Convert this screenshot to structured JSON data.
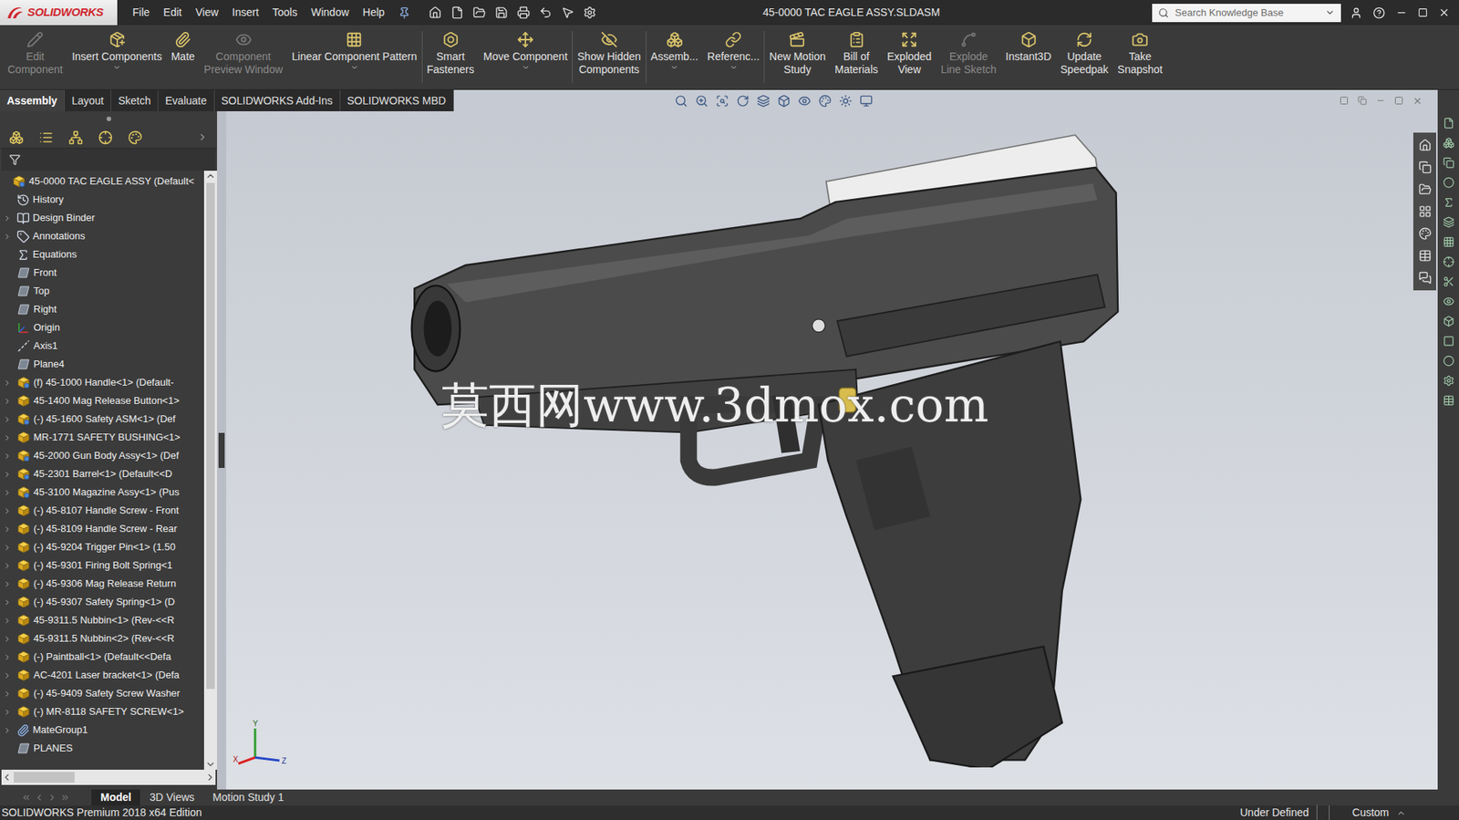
{
  "window": {
    "title": "45-0000 TAC EAGLE ASSY.SLDASM"
  },
  "logo": {
    "brand": "SOLIDWORKS"
  },
  "menu": [
    "File",
    "Edit",
    "View",
    "Insert",
    "Tools",
    "Window",
    "Help"
  ],
  "search": {
    "placeholder": "Search Knowledge Base"
  },
  "ribbon": [
    {
      "label": [
        "Edit",
        "Component"
      ],
      "disabled": true,
      "dropdown": false,
      "group_start": false
    },
    {
      "label": [
        "Insert Components"
      ],
      "disabled": false,
      "dropdown": true,
      "group_start": false
    },
    {
      "label": [
        "Mate"
      ],
      "disabled": false,
      "dropdown": false,
      "group_start": false
    },
    {
      "label": [
        "Component",
        "Preview Window"
      ],
      "disabled": true,
      "dropdown": false,
      "group_start": false
    },
    {
      "label": [
        "Linear Component Pattern"
      ],
      "disabled": false,
      "dropdown": true,
      "group_start": false
    },
    {
      "label": [
        "Smart",
        "Fasteners"
      ],
      "disabled": false,
      "dropdown": false,
      "group_start": true
    },
    {
      "label": [
        "Move Component"
      ],
      "disabled": false,
      "dropdown": true,
      "group_start": false
    },
    {
      "label": [
        "Show Hidden",
        "Components"
      ],
      "disabled": false,
      "dropdown": false,
      "group_start": true
    },
    {
      "label": [
        "Assemb..."
      ],
      "disabled": false,
      "dropdown": true,
      "group_start": true
    },
    {
      "label": [
        "Referenc..."
      ],
      "disabled": false,
      "dropdown": true,
      "group_start": false
    },
    {
      "label": [
        "New Motion",
        "Study"
      ],
      "disabled": false,
      "dropdown": false,
      "group_start": true
    },
    {
      "label": [
        "Bill of",
        "Materials"
      ],
      "disabled": false,
      "dropdown": false,
      "group_start": false
    },
    {
      "label": [
        "Exploded",
        "View"
      ],
      "disabled": false,
      "dropdown": false,
      "group_start": false
    },
    {
      "label": [
        "Explode",
        "Line Sketch"
      ],
      "disabled": true,
      "dropdown": false,
      "group_start": false
    },
    {
      "label": [
        "Instant3D"
      ],
      "disabled": false,
      "dropdown": false,
      "group_start": false
    },
    {
      "label": [
        "Update",
        "Speedpak"
      ],
      "disabled": false,
      "dropdown": false,
      "group_start": false
    },
    {
      "label": [
        "Take",
        "Snapshot"
      ],
      "disabled": false,
      "dropdown": false,
      "group_start": false
    }
  ],
  "command_tabs": [
    {
      "label": "Assembly",
      "selected": true
    },
    {
      "label": "Layout",
      "selected": false
    },
    {
      "label": "Sketch",
      "selected": false
    },
    {
      "label": "Evaluate",
      "selected": false
    },
    {
      "label": "SOLIDWORKS Add-Ins",
      "selected": false
    },
    {
      "label": "SOLIDWORKS MBD",
      "selected": false
    }
  ],
  "feature_tree": [
    {
      "label": "45-0000 TAC EAGLE ASSY  (Default<",
      "expandable": false,
      "icon": "root"
    },
    {
      "label": "History",
      "expandable": false,
      "icon": "history"
    },
    {
      "label": "Design Binder",
      "expandable": true,
      "icon": "binder"
    },
    {
      "label": "Annotations",
      "expandable": true,
      "icon": "annotations"
    },
    {
      "label": "Equations",
      "expandable": false,
      "icon": "equations"
    },
    {
      "label": "Front",
      "expandable": false,
      "icon": "plane"
    },
    {
      "label": "Top",
      "expandable": false,
      "icon": "plane"
    },
    {
      "label": "Right",
      "expandable": false,
      "icon": "plane"
    },
    {
      "label": "Origin",
      "expandable": false,
      "icon": "origin"
    },
    {
      "label": "Axis1",
      "expandable": false,
      "icon": "axis"
    },
    {
      "label": "Plane4",
      "expandable": false,
      "icon": "plane"
    },
    {
      "label": "(f) 45-1000 Handle<1> (Default-",
      "expandable": true,
      "icon": "assembly"
    },
    {
      "label": "45-1400 Mag Release Button<1>",
      "expandable": true,
      "icon": "part"
    },
    {
      "label": "(-) 45-1600 Safety ASM<1> (Def",
      "expandable": true,
      "icon": "assembly"
    },
    {
      "label": "MR-1771 SAFETY BUSHING<1>",
      "expandable": true,
      "icon": "part"
    },
    {
      "label": "45-2000 Gun Body Assy<1> (Def",
      "expandable": true,
      "icon": "assembly"
    },
    {
      "label": "45-2301 Barrel<1> (Default<<D",
      "expandable": true,
      "icon": "assembly"
    },
    {
      "label": "45-3100 Magazine Assy<1> (Pus",
      "expandable": true,
      "icon": "assembly"
    },
    {
      "label": "(-) 45-8107 Handle Screw - Front",
      "expandable": true,
      "icon": "part"
    },
    {
      "label": "(-) 45-8109 Handle Screw - Rear",
      "expandable": true,
      "icon": "part"
    },
    {
      "label": "(-) 45-9204 Trigger Pin<1> (1.50",
      "expandable": true,
      "icon": "part"
    },
    {
      "label": "(-) 45-9301 Firing Bolt Spring<1",
      "expandable": true,
      "icon": "part"
    },
    {
      "label": "(-) 45-9306 Mag Release Return",
      "expandable": true,
      "icon": "part"
    },
    {
      "label": "(-) 45-9307 Safety Spring<1> (D",
      "expandable": true,
      "icon": "part"
    },
    {
      "label": "45-9311.5 Nubbin<1> (Rev-<<R",
      "expandable": true,
      "icon": "part"
    },
    {
      "label": "45-9311.5 Nubbin<2> (Rev-<<R",
      "expandable": true,
      "icon": "part"
    },
    {
      "label": "(-) Paintball<1> (Default<<Defa",
      "expandable": true,
      "icon": "part"
    },
    {
      "label": "AC-4201 Laser bracket<1> (Defa",
      "expandable": true,
      "icon": "part"
    },
    {
      "label": "(-) 45-9409 Safety Screw Washer",
      "expandable": true,
      "icon": "part"
    },
    {
      "label": "(-) MR-8118 SAFETY SCREW<1>",
      "expandable": true,
      "icon": "part"
    },
    {
      "label": "MateGroup1",
      "expandable": true,
      "icon": "mategroup"
    },
    {
      "label": "PLANES",
      "expandable": false,
      "icon": "plane"
    }
  ],
  "viewport": {
    "watermark": "莫西网www.3dmox.com",
    "triad": [
      "X",
      "Y",
      "Z"
    ]
  },
  "bottom_tabs": [
    {
      "label": "Model",
      "selected": true
    },
    {
      "label": "3D Views",
      "selected": false
    },
    {
      "label": "Motion Study 1",
      "selected": false
    }
  ],
  "status_bar": {
    "edition": "SOLIDWORKS Premium 2018 x64 Edition",
    "state": "Under Defined",
    "units": "Custom"
  }
}
